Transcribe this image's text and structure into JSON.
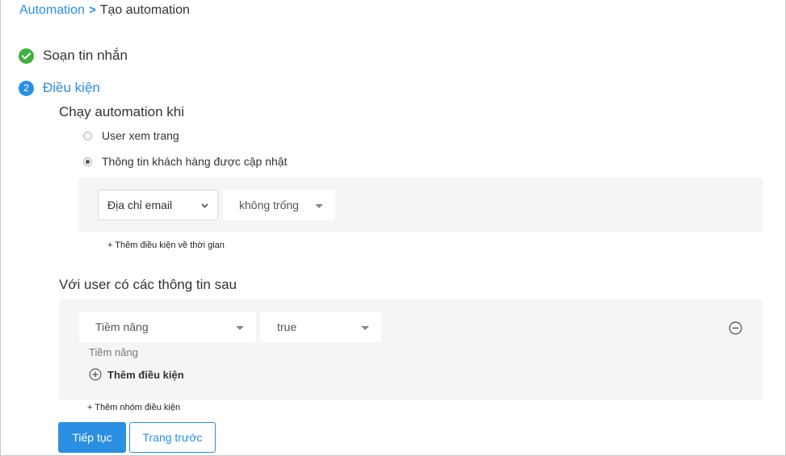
{
  "breadcrumb": {
    "parent": "Automation",
    "separator": ">",
    "current": "Tạo automation"
  },
  "steps": [
    {
      "title": "Soạn tin nhắn",
      "status": "done",
      "icon": "check-circle-icon",
      "color": "#3eb13e"
    },
    {
      "title": "Điều kiện",
      "number": "2",
      "status": "current",
      "color": "#2a8fe0"
    }
  ],
  "trigger": {
    "title": "Chạy automation khi",
    "options": [
      {
        "label": "User xem trang",
        "selected": false
      },
      {
        "label": "Thông tin khách hàng được cập nhật",
        "selected": true
      }
    ],
    "field_select": "Địa chỉ email",
    "operator_select": "không trống",
    "add_time_condition": "+ Thêm điều kiện về thời gian"
  },
  "filters": {
    "title": "Với user có các thông tin sau",
    "field_select": "Tiềm năng",
    "value_select": "true",
    "hint": "Tiềm năng",
    "add_condition": "Thêm điều kiện",
    "add_group": "+ Thêm nhóm điều kiện"
  },
  "actions": {
    "next": "Tiếp tục",
    "back": "Trang trước"
  },
  "colors": {
    "accent": "#2a8fe0",
    "panel_bg": "#f4f5f7",
    "success": "#3eb13e"
  }
}
